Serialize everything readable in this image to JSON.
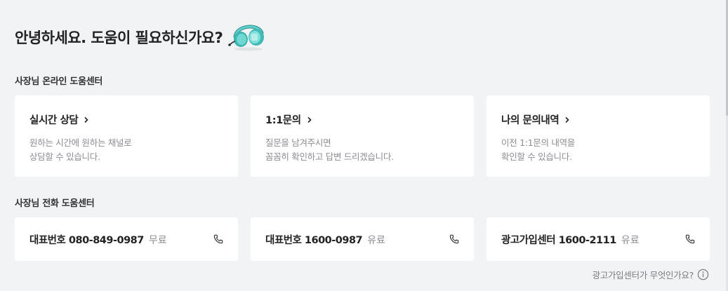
{
  "header": {
    "title": "안녕하세요. 도움이 필요하신가요?",
    "icon": "headset-icon"
  },
  "online_center": {
    "label": "사장님 온라인 도움센터",
    "cards": [
      {
        "title": "실시간 상담",
        "desc_line1": "원하는 시간에 원하는 채널로",
        "desc_line2": "상담할 수 있습니다."
      },
      {
        "title": "1:1문의",
        "desc_line1": "질문을 남겨주시면",
        "desc_line2": "꼼꼼히 확인하고 답변 드리겠습니다."
      },
      {
        "title": "나의 문의내역",
        "desc_line1": "이전 1:1문의 내역을",
        "desc_line2": "확인할 수 있습니다."
      }
    ]
  },
  "phone_center": {
    "label": "사장님 전화 도움센터",
    "cards": [
      {
        "name": "대표번호 080-849-0987",
        "fee": "무료"
      },
      {
        "name": "대표번호 1600-0987",
        "fee": "유료"
      },
      {
        "name": "광고가입센터 1600-2111",
        "fee": "유료"
      }
    ]
  },
  "ad_link": {
    "label": "광고가입센터가 무엇인가요?",
    "icon": "info-icon"
  },
  "colors": {
    "background": "#f2f3f5",
    "card": "#ffffff",
    "headset": "#4ec3bf",
    "muted_text": "#8b8d93"
  }
}
